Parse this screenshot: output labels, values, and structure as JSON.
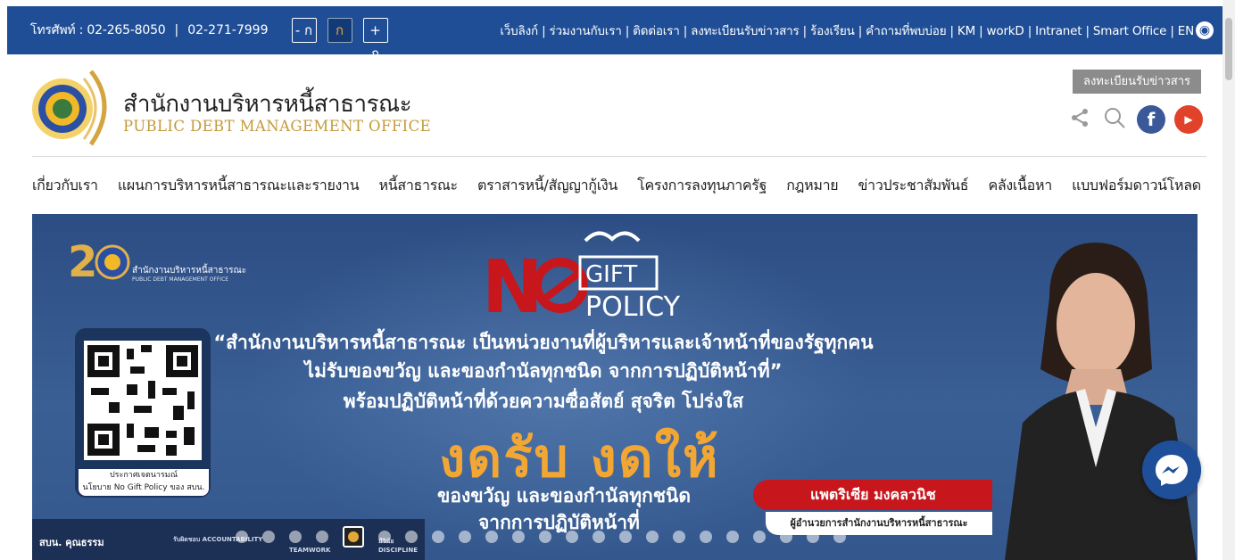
{
  "topbar": {
    "phone_label": "โทรศัพท์ : 02-265-8050",
    "separator": "|",
    "phone2": "02-271-7999",
    "font_buttons": [
      "- ก",
      "ก",
      "+ ก"
    ],
    "links": "เว็บลิงก์ | ร่วมงานกับเรา | ติดต่อเรา | ลงทะเบียนรับข่าวสาร | ร้องเรียน | คำถามที่พบบ่อย | KM | workD | Intranet | Smart Office | EN"
  },
  "header": {
    "org_name_th": "สำนักงานบริหารหนี้สาธารณะ",
    "org_name_en": "PUBLIC DEBT MANAGEMENT OFFICE",
    "register_button": "ลงทะเบียนรับข่าวสาร"
  },
  "icons": {
    "share": "share-icon",
    "search": "search-icon",
    "facebook": "facebook-icon",
    "youtube": "youtube-icon",
    "globe": "globe-icon",
    "messenger": "messenger-icon"
  },
  "nav": {
    "items": [
      "เกี่ยวกับเรา",
      "แผนการบริหารหนี้สาธารณะและรายงาน",
      "หนี้สาธารณะ",
      "ตราสารหนี้/สัญญากู้เงิน",
      "โครงการลงทุนภาครัฐ",
      "กฎหมาย",
      "ข่าวประชาสัมพันธ์",
      "คลังเนื้อหา",
      "แบบฟอร์มดาวน์โหลด"
    ]
  },
  "banner": {
    "org_th": "สำนักงานบริหารหนี้สาธารณะ",
    "org_en": "PUBLIC DEBT MANAGEMENT OFFICE",
    "no_gift_word": "GIFT",
    "no_gift_word2": "POLICY",
    "quote_line1": "“สำนักงานบริหารหนี้สาธารณะ เป็นหน่วยงานที่ผู้บริหารและเจ้าหน้าที่ของรัฐทุกคน",
    "quote_line2": "ไม่รับของขวัญ และของกำนัลทุกชนิด จากการปฏิบัติหน้าที่”",
    "quote_line3": "พร้อมปฏิบัติหน้าที่ด้วยความซื่อสัตย์ สุจริต โปร่งใส",
    "headline": "งดรับ งดให้",
    "sub_line1": "ของขวัญ และของกำนัลทุกชนิด",
    "sub_line2": "จากการปฏิบัติหน้าที่",
    "qr_caption_1": "ประกาศเจตนารมณ์",
    "qr_caption_2": "นโยบาย No Gift Policy ของ สบน.",
    "person_name": "แพตริเซีย มงคลวนิช",
    "person_title": "ผู้อำนวยการสำนักงานบริหารหนี้สาธารณะ",
    "footer_label": "สบน. คุณธรรม",
    "values": [
      "รับผิดชอบ ACCOUNTABILITY",
      "TEAMWORK",
      "มีวินัย DISCIPLINE"
    ],
    "slide_count": 23,
    "active_slide": 4
  },
  "colors": {
    "topbar": "#1f4e96",
    "banner": "#3a5f95",
    "accent": "#f2a634",
    "name_tag": "#c8161d",
    "gold": "#c39a3a"
  }
}
